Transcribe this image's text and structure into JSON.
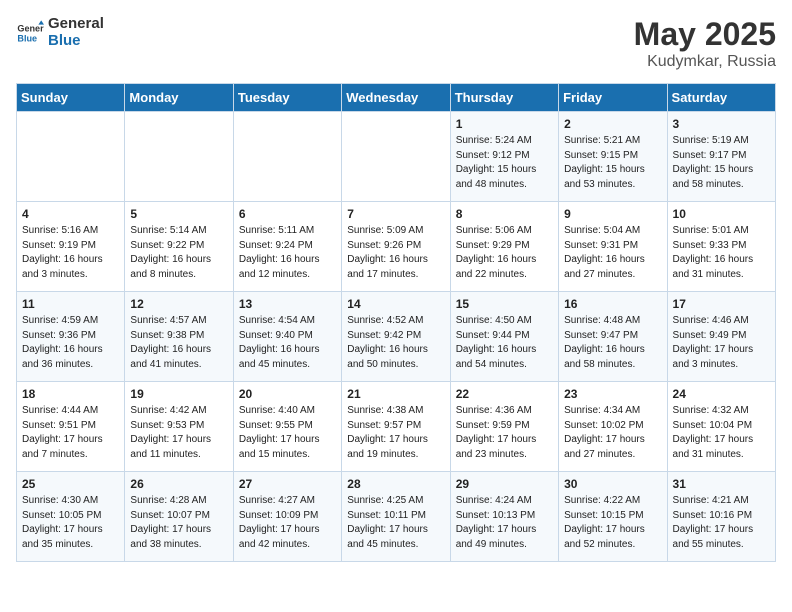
{
  "header": {
    "logo_general": "General",
    "logo_blue": "Blue",
    "month_year": "May 2025",
    "location": "Kudymkar, Russia"
  },
  "days_of_week": [
    "Sunday",
    "Monday",
    "Tuesday",
    "Wednesday",
    "Thursday",
    "Friday",
    "Saturday"
  ],
  "weeks": [
    [
      {
        "day": "",
        "text": ""
      },
      {
        "day": "",
        "text": ""
      },
      {
        "day": "",
        "text": ""
      },
      {
        "day": "",
        "text": ""
      },
      {
        "day": "1",
        "text": "Sunrise: 5:24 AM\nSunset: 9:12 PM\nDaylight: 15 hours\nand 48 minutes."
      },
      {
        "day": "2",
        "text": "Sunrise: 5:21 AM\nSunset: 9:15 PM\nDaylight: 15 hours\nand 53 minutes."
      },
      {
        "day": "3",
        "text": "Sunrise: 5:19 AM\nSunset: 9:17 PM\nDaylight: 15 hours\nand 58 minutes."
      }
    ],
    [
      {
        "day": "4",
        "text": "Sunrise: 5:16 AM\nSunset: 9:19 PM\nDaylight: 16 hours\nand 3 minutes."
      },
      {
        "day": "5",
        "text": "Sunrise: 5:14 AM\nSunset: 9:22 PM\nDaylight: 16 hours\nand 8 minutes."
      },
      {
        "day": "6",
        "text": "Sunrise: 5:11 AM\nSunset: 9:24 PM\nDaylight: 16 hours\nand 12 minutes."
      },
      {
        "day": "7",
        "text": "Sunrise: 5:09 AM\nSunset: 9:26 PM\nDaylight: 16 hours\nand 17 minutes."
      },
      {
        "day": "8",
        "text": "Sunrise: 5:06 AM\nSunset: 9:29 PM\nDaylight: 16 hours\nand 22 minutes."
      },
      {
        "day": "9",
        "text": "Sunrise: 5:04 AM\nSunset: 9:31 PM\nDaylight: 16 hours\nand 27 minutes."
      },
      {
        "day": "10",
        "text": "Sunrise: 5:01 AM\nSunset: 9:33 PM\nDaylight: 16 hours\nand 31 minutes."
      }
    ],
    [
      {
        "day": "11",
        "text": "Sunrise: 4:59 AM\nSunset: 9:36 PM\nDaylight: 16 hours\nand 36 minutes."
      },
      {
        "day": "12",
        "text": "Sunrise: 4:57 AM\nSunset: 9:38 PM\nDaylight: 16 hours\nand 41 minutes."
      },
      {
        "day": "13",
        "text": "Sunrise: 4:54 AM\nSunset: 9:40 PM\nDaylight: 16 hours\nand 45 minutes."
      },
      {
        "day": "14",
        "text": "Sunrise: 4:52 AM\nSunset: 9:42 PM\nDaylight: 16 hours\nand 50 minutes."
      },
      {
        "day": "15",
        "text": "Sunrise: 4:50 AM\nSunset: 9:44 PM\nDaylight: 16 hours\nand 54 minutes."
      },
      {
        "day": "16",
        "text": "Sunrise: 4:48 AM\nSunset: 9:47 PM\nDaylight: 16 hours\nand 58 minutes."
      },
      {
        "day": "17",
        "text": "Sunrise: 4:46 AM\nSunset: 9:49 PM\nDaylight: 17 hours\nand 3 minutes."
      }
    ],
    [
      {
        "day": "18",
        "text": "Sunrise: 4:44 AM\nSunset: 9:51 PM\nDaylight: 17 hours\nand 7 minutes."
      },
      {
        "day": "19",
        "text": "Sunrise: 4:42 AM\nSunset: 9:53 PM\nDaylight: 17 hours\nand 11 minutes."
      },
      {
        "day": "20",
        "text": "Sunrise: 4:40 AM\nSunset: 9:55 PM\nDaylight: 17 hours\nand 15 minutes."
      },
      {
        "day": "21",
        "text": "Sunrise: 4:38 AM\nSunset: 9:57 PM\nDaylight: 17 hours\nand 19 minutes."
      },
      {
        "day": "22",
        "text": "Sunrise: 4:36 AM\nSunset: 9:59 PM\nDaylight: 17 hours\nand 23 minutes."
      },
      {
        "day": "23",
        "text": "Sunrise: 4:34 AM\nSunset: 10:02 PM\nDaylight: 17 hours\nand 27 minutes."
      },
      {
        "day": "24",
        "text": "Sunrise: 4:32 AM\nSunset: 10:04 PM\nDaylight: 17 hours\nand 31 minutes."
      }
    ],
    [
      {
        "day": "25",
        "text": "Sunrise: 4:30 AM\nSunset: 10:05 PM\nDaylight: 17 hours\nand 35 minutes."
      },
      {
        "day": "26",
        "text": "Sunrise: 4:28 AM\nSunset: 10:07 PM\nDaylight: 17 hours\nand 38 minutes."
      },
      {
        "day": "27",
        "text": "Sunrise: 4:27 AM\nSunset: 10:09 PM\nDaylight: 17 hours\nand 42 minutes."
      },
      {
        "day": "28",
        "text": "Sunrise: 4:25 AM\nSunset: 10:11 PM\nDaylight: 17 hours\nand 45 minutes."
      },
      {
        "day": "29",
        "text": "Sunrise: 4:24 AM\nSunset: 10:13 PM\nDaylight: 17 hours\nand 49 minutes."
      },
      {
        "day": "30",
        "text": "Sunrise: 4:22 AM\nSunset: 10:15 PM\nDaylight: 17 hours\nand 52 minutes."
      },
      {
        "day": "31",
        "text": "Sunrise: 4:21 AM\nSunset: 10:16 PM\nDaylight: 17 hours\nand 55 minutes."
      }
    ]
  ]
}
